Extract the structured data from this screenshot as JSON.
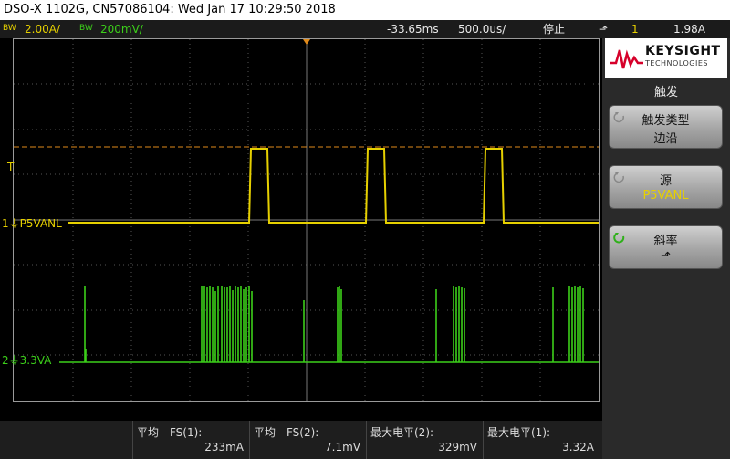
{
  "title": "DSO-X 1102G, CN57086104: Wed Jan 17 10:29:50 2018",
  "status": {
    "ch1_bw": "BW",
    "ch1_scale": "2.00A/",
    "ch2_bw": "BW",
    "ch2_scale": "200mV/",
    "h_offset": "-33.65ms",
    "timebase": "500.0us/",
    "run_state": "停止",
    "trig_source": "1",
    "trig_level": "1.98A"
  },
  "channels": {
    "ch1_num": "1",
    "ch1_label": "P5VANL",
    "ch2_num": "2",
    "ch2_label": "3.3VA",
    "trigger_marker": "T"
  },
  "panel": {
    "brand": "KEYSIGHT",
    "brand_sub": "TECHNOLOGIES",
    "menu_title": "触发",
    "softkeys": [
      {
        "label": "触发类型",
        "value": "边沿"
      },
      {
        "label": "源",
        "value": "P5VANL"
      },
      {
        "label": "斜率",
        "value": "⬏"
      }
    ]
  },
  "measurements": [
    {
      "label": "平均 - FS(1):",
      "value": "233mA"
    },
    {
      "label": "平均 - FS(2):",
      "value": "7.1mV"
    },
    {
      "label": "最大电平(2):",
      "value": "329mV"
    },
    {
      "label": "最大电平(1):",
      "value": "3.32A"
    }
  ],
  "colors": {
    "ch1": "#e6d000",
    "ch2": "#3ccf1a",
    "trigger_line": "#e08a1a"
  }
}
